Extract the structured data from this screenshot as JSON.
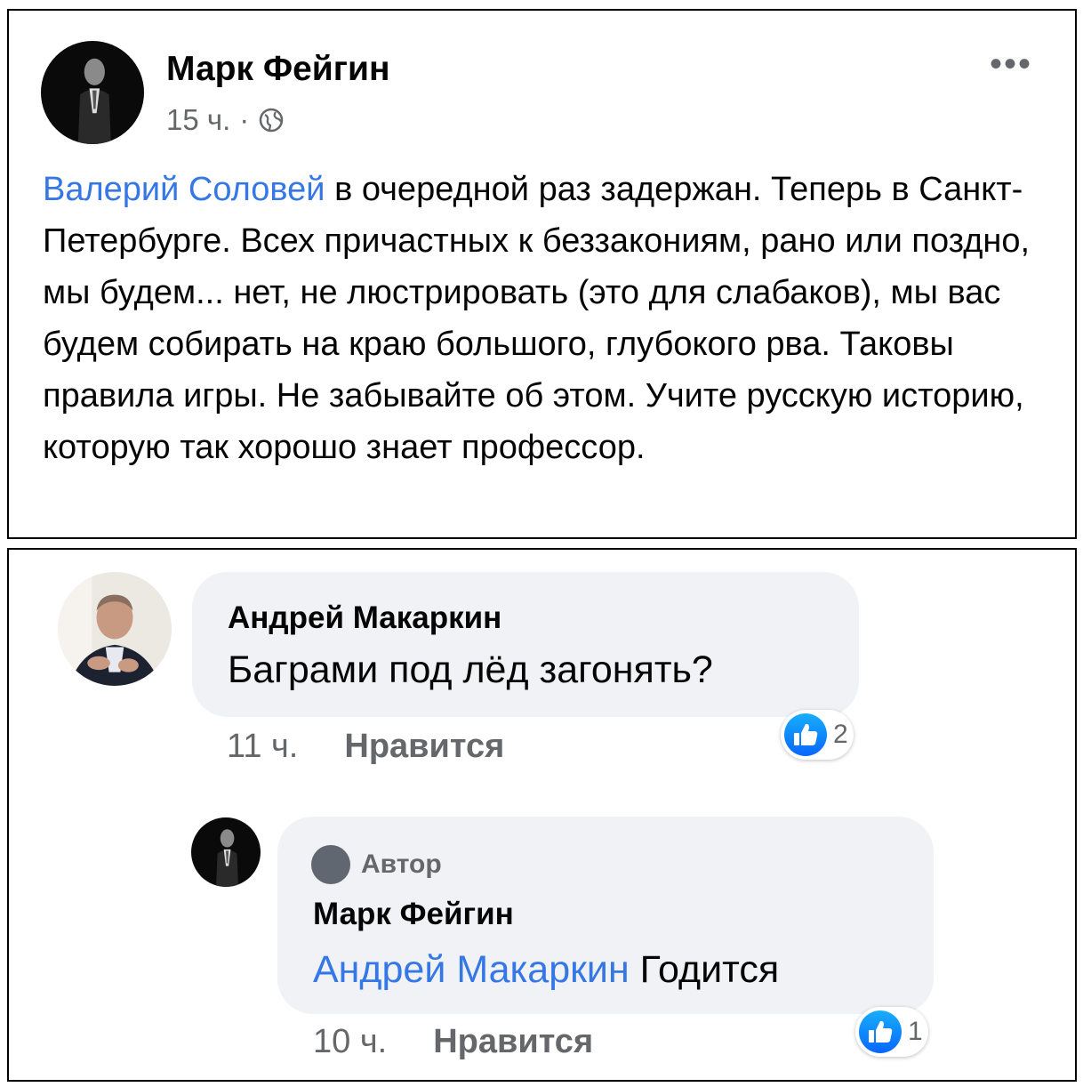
{
  "post": {
    "author": "Марк Фейгин",
    "time": "15 ч.",
    "separator": "·",
    "privacy_icon": "globe-icon",
    "more_icon": "more-horizontal-icon",
    "more_label": "•••",
    "mention": "Валерий Соловей",
    "text": " в очередной раз задержан. Теперь в Санкт-Петербурге. Всех причастных к беззакониям, рано или поздно, мы будем... нет, не люстрировать (это для слабаков), мы вас будем собирать на краю большого, глубокого рва. Таковы правила игры. Не забывайте об этом. Учите русскую историю, которую так хорошо знает профессор."
  },
  "comments": [
    {
      "author": "Андрей Макаркин",
      "text": "Баграми под лёд загонять?",
      "time": "11 ч.",
      "like_label": "Нравится",
      "reaction_icon": "like-reaction-icon",
      "reaction_count": "2"
    },
    {
      "badge": "Автор",
      "author": "Марк Фейгин",
      "mention": "Андрей Макаркин",
      "text": " Годится",
      "time": "10 ч.",
      "like_label": "Нравится",
      "reaction_icon": "like-reaction-icon",
      "reaction_count": "1"
    }
  ],
  "colors": {
    "mention": "#3578e5",
    "meta": "#65676b",
    "bubble": "#f0f2f5",
    "like_blue": "#1877f2"
  }
}
